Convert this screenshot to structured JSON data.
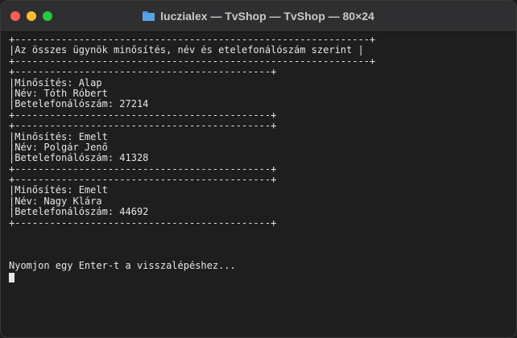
{
  "window": {
    "title": "luczialex — TvShop — TvShop — 80×24",
    "title_icon": "folder-icon",
    "buttons": [
      "close",
      "minimize",
      "zoom"
    ]
  },
  "terminal": {
    "lines": [
      "+-------------------------------------------------------------+",
      "|Az összes ügynök minősítés, név és etelefonálószám szerint |",
      "+-------------------------------------------------------------+",
      "+--------------------------------------------+",
      "|Minősítés: Alap",
      "|Név: Tóth Róbert",
      "|Betelefonálószám: 27214",
      "+--------------------------------------------+",
      "+--------------------------------------------+",
      "|Minősítés: Emelt",
      "|Név: Polgár Jenő",
      "|Betelefonálószám: 41328",
      "+--------------------------------------------+",
      "+--------------------------------------------+",
      "|Minősítés: Emelt",
      "|Név: Nagy Klára",
      "|Betelefonálószám: 44692",
      "+--------------------------------------------+",
      "",
      "",
      "",
      "Nyomjon egy Enter-t a visszalépéshez...",
      "",
      "",
      ""
    ]
  },
  "colors": {
    "background": "#1e1e1e",
    "text": "#e6e6e6",
    "titlebar": "#2f2f31",
    "close": "#ff5f57",
    "minimize": "#febc2e",
    "zoom": "#28c840"
  }
}
